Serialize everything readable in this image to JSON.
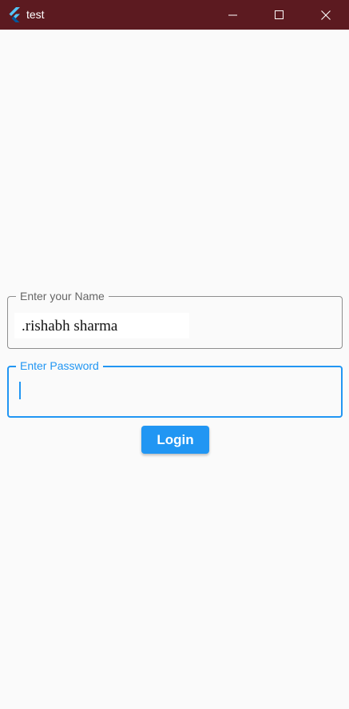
{
  "window": {
    "title": "test",
    "icon": "flutter-logo-icon",
    "controls": {
      "minimize_icon": "minimize-icon",
      "maximize_icon": "maximize-icon",
      "close_icon": "close-icon"
    }
  },
  "form": {
    "name_field": {
      "label": "Enter your Name",
      "value": ".rishabh sharma"
    },
    "password_field": {
      "label": "Enter Password",
      "value": ""
    },
    "login_label": "Login"
  },
  "colors": {
    "titlebar": "#5c1a20",
    "accent": "#2196f3",
    "background": "#fafafa",
    "border_idle": "#8e8e8e"
  }
}
